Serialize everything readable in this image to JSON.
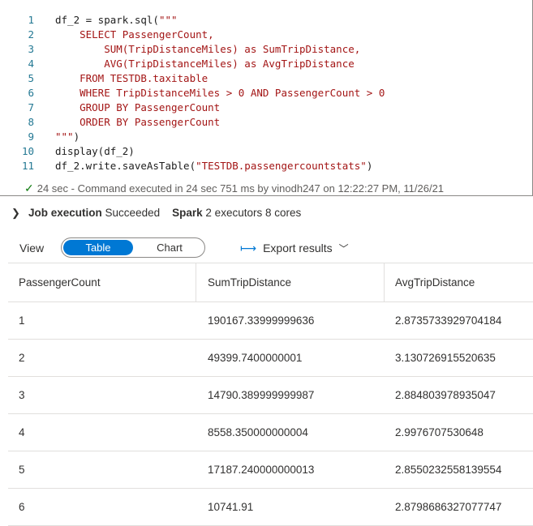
{
  "code_lines": [
    {
      "num": "1",
      "parts": [
        {
          "t": "df_2 = spark.sql(",
          "s": false
        },
        {
          "t": "\"\"\"",
          "s": true
        }
      ]
    },
    {
      "num": "2",
      "parts": [
        {
          "t": "    SELECT PassengerCount,",
          "s": true
        }
      ]
    },
    {
      "num": "3",
      "parts": [
        {
          "t": "        SUM(TripDistanceMiles) as SumTripDistance,",
          "s": true
        }
      ]
    },
    {
      "num": "4",
      "parts": [
        {
          "t": "        AVG(TripDistanceMiles) as AvgTripDistance",
          "s": true
        }
      ]
    },
    {
      "num": "5",
      "parts": [
        {
          "t": "    FROM TESTDB.taxitable",
          "s": true
        }
      ]
    },
    {
      "num": "6",
      "parts": [
        {
          "t": "    WHERE TripDistanceMiles > 0 AND PassengerCount > 0",
          "s": true
        }
      ]
    },
    {
      "num": "7",
      "parts": [
        {
          "t": "    GROUP BY PassengerCount",
          "s": true
        }
      ]
    },
    {
      "num": "8",
      "parts": [
        {
          "t": "    ORDER BY PassengerCount",
          "s": true
        }
      ]
    },
    {
      "num": "9",
      "parts": [
        {
          "t": "\"\"\"",
          "s": true
        },
        {
          "t": ")",
          "s": false
        }
      ]
    },
    {
      "num": "10",
      "parts": [
        {
          "t": "display(df_2)",
          "s": false
        }
      ]
    },
    {
      "num": "11",
      "parts": [
        {
          "t": "df_2.write.saveAsTable(",
          "s": false
        },
        {
          "t": "\"TESTDB.passengercountstats\"",
          "s": true
        },
        {
          "t": ")",
          "s": false
        }
      ]
    }
  ],
  "status": {
    "text": "24 sec - Command executed in 24 sec 751 ms by vinodh247 on 12:22:27 PM, 11/26/21"
  },
  "job": {
    "label": "Job execution",
    "state": "Succeeded",
    "spark_label": "Spark",
    "spark_info": "2 executors 8 cores"
  },
  "view": {
    "label": "View",
    "table_tab": "Table",
    "chart_tab": "Chart",
    "export_label": "Export results"
  },
  "table": {
    "headers": [
      "PassengerCount",
      "SumTripDistance",
      "AvgTripDistance"
    ],
    "rows": [
      [
        "1",
        "190167.33999999636",
        "2.8735733929704184"
      ],
      [
        "2",
        "49399.7400000001",
        "3.130726915520635"
      ],
      [
        "3",
        "14790.389999999987",
        "2.884803978935047"
      ],
      [
        "4",
        "8558.350000000004",
        "2.9976707530648"
      ],
      [
        "5",
        "17187.240000000013",
        "2.8550232558139554"
      ],
      [
        "6",
        "10741.91",
        "2.8798686327077747"
      ]
    ]
  },
  "colors": {
    "accent": "#0078d4",
    "success": "#107c10",
    "string": "#a31515",
    "line_number": "#237893"
  }
}
